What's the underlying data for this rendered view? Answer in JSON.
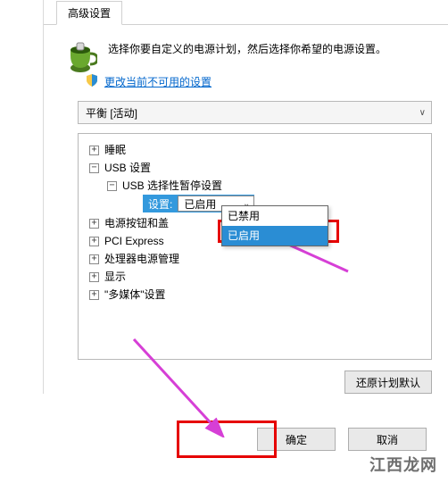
{
  "tab": {
    "label": "高级设置"
  },
  "intro": {
    "text": "选择你要自定义的电源计划，然后选择你希望的电源设置。"
  },
  "link": {
    "label": "更改当前不可用的设置"
  },
  "plan_select": {
    "value": "平衡 [活动]"
  },
  "tree": {
    "sleep": {
      "label": "睡眠",
      "expanded": false
    },
    "usb": {
      "label": "USB 设置",
      "expanded": true
    },
    "usb_suspend": {
      "label": "USB 选择性暂停设置",
      "expanded": true
    },
    "setting_label": "设置:",
    "setting_value": "已启用",
    "power_buttons": {
      "label": "电源按钮和盖"
    },
    "pci": {
      "label": "PCI Express"
    },
    "cpu": {
      "label": "处理器电源管理"
    },
    "display": {
      "label": "显示"
    },
    "multimedia": {
      "label": "\"多媒体\"设置"
    }
  },
  "dropdown": {
    "options": [
      "已禁用",
      "已启用"
    ],
    "selected_index": 1
  },
  "restore_defaults": {
    "label": "还原计划默认"
  },
  "buttons": {
    "ok": "确定",
    "cancel": "取消"
  },
  "watermark": "江西龙网",
  "annotation": {
    "color": "#e60000",
    "arrow_color": "#d63fd6"
  }
}
